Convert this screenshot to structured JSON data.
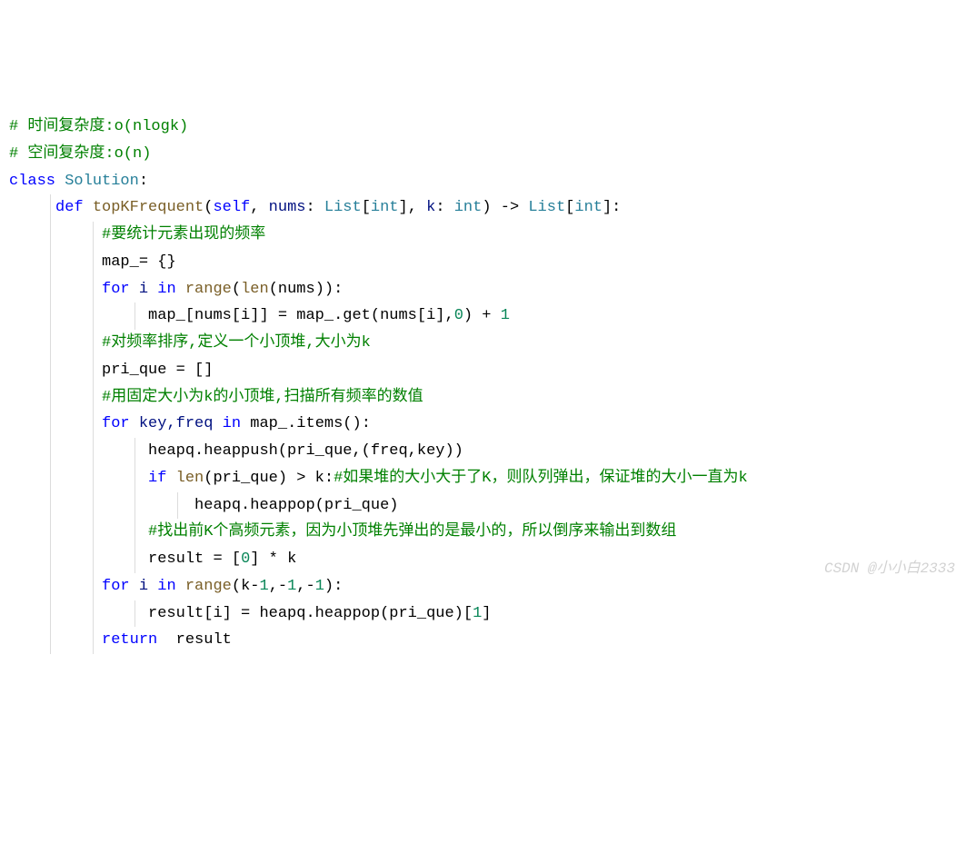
{
  "code": {
    "lines": [
      {
        "indent": 0,
        "guides": [],
        "tokens": [
          {
            "t": "# 时间复杂度:o(nlogk)",
            "c": "tok-comment"
          }
        ]
      },
      {
        "indent": 0,
        "guides": [],
        "tokens": [
          {
            "t": "# 空间复杂度:o(n)",
            "c": "tok-comment"
          }
        ]
      },
      {
        "indent": 0,
        "guides": [],
        "tokens": [
          {
            "t": "class ",
            "c": "tok-classkw"
          },
          {
            "t": "Solution",
            "c": "tok-classname"
          },
          {
            "t": ":",
            "c": "tok-op"
          }
        ]
      },
      {
        "indent": 1,
        "guides": [
          "g1"
        ],
        "tokens": [
          {
            "t": "def ",
            "c": "tok-def"
          },
          {
            "t": "topKFrequent",
            "c": "tok-func"
          },
          {
            "t": "(",
            "c": "tok-op"
          },
          {
            "t": "self",
            "c": "tok-self"
          },
          {
            "t": ", ",
            "c": "tok-op"
          },
          {
            "t": "nums",
            "c": "tok-param"
          },
          {
            "t": ": ",
            "c": "tok-op"
          },
          {
            "t": "List",
            "c": "tok-type"
          },
          {
            "t": "[",
            "c": "tok-op"
          },
          {
            "t": "int",
            "c": "tok-type"
          },
          {
            "t": "], ",
            "c": "tok-op"
          },
          {
            "t": "k",
            "c": "tok-param"
          },
          {
            "t": ": ",
            "c": "tok-op"
          },
          {
            "t": "int",
            "c": "tok-type"
          },
          {
            "t": ") -> ",
            "c": "tok-op"
          },
          {
            "t": "List",
            "c": "tok-type"
          },
          {
            "t": "[",
            "c": "tok-op"
          },
          {
            "t": "int",
            "c": "tok-type"
          },
          {
            "t": "]:",
            "c": "tok-op"
          }
        ]
      },
      {
        "indent": 2,
        "guides": [
          "g1",
          "g2"
        ],
        "tokens": [
          {
            "t": "#要统计元素出现的频率",
            "c": "tok-comment"
          }
        ]
      },
      {
        "indent": 2,
        "guides": [
          "g1",
          "g2"
        ],
        "tokens": [
          {
            "t": "map_= {}",
            "c": "tok-op"
          }
        ]
      },
      {
        "indent": 2,
        "guides": [
          "g1",
          "g2"
        ],
        "tokens": [
          {
            "t": "for ",
            "c": "tok-keyword"
          },
          {
            "t": "i ",
            "c": "tok-param"
          },
          {
            "t": "in ",
            "c": "tok-keyword"
          },
          {
            "t": "range",
            "c": "tok-func"
          },
          {
            "t": "(",
            "c": "tok-op"
          },
          {
            "t": "len",
            "c": "tok-func"
          },
          {
            "t": "(nums)):",
            "c": "tok-op"
          }
        ]
      },
      {
        "indent": 3,
        "guides": [
          "g1",
          "g2",
          "g3"
        ],
        "tokens": [
          {
            "t": "map_[nums[i]] = map_.get(nums[i],",
            "c": "tok-op"
          },
          {
            "t": "0",
            "c": "tok-num"
          },
          {
            "t": ") + ",
            "c": "tok-op"
          },
          {
            "t": "1",
            "c": "tok-num"
          }
        ]
      },
      {
        "indent": 2,
        "guides": [
          "g1",
          "g2"
        ],
        "tokens": [
          {
            "t": "#对频率排序,定义一个小顶堆,大小为k",
            "c": "tok-comment"
          }
        ]
      },
      {
        "indent": 2,
        "guides": [
          "g1",
          "g2"
        ],
        "tokens": [
          {
            "t": "pri_que = []",
            "c": "tok-op"
          }
        ]
      },
      {
        "indent": 2,
        "guides": [
          "g1",
          "g2"
        ],
        "tokens": [
          {
            "t": "#用固定大小为k的小顶堆,扫描所有频率的数值",
            "c": "tok-comment"
          }
        ]
      },
      {
        "indent": 2,
        "guides": [
          "g1",
          "g2"
        ],
        "tokens": [
          {
            "t": "for ",
            "c": "tok-keyword"
          },
          {
            "t": "key,freq ",
            "c": "tok-param"
          },
          {
            "t": "in ",
            "c": "tok-keyword"
          },
          {
            "t": "map_.items():",
            "c": "tok-op"
          }
        ]
      },
      {
        "indent": 3,
        "guides": [
          "g1",
          "g2",
          "g3"
        ],
        "tokens": [
          {
            "t": "heapq.heappush(pri_que,(freq,key))",
            "c": "tok-op"
          }
        ]
      },
      {
        "indent": 3,
        "guides": [
          "g1",
          "g2",
          "g3"
        ],
        "tokens": [
          {
            "t": "if ",
            "c": "tok-keyword"
          },
          {
            "t": "len",
            "c": "tok-func"
          },
          {
            "t": "(pri_que) > k:",
            "c": "tok-op"
          },
          {
            "t": "#如果堆的大小大于了K，则队列弹出，保证堆的大小一直为k",
            "c": "tok-comment"
          }
        ]
      },
      {
        "indent": 4,
        "guides": [
          "g1",
          "g2",
          "g3",
          "g4"
        ],
        "tokens": [
          {
            "t": "heapq.heappop(pri_que)",
            "c": "tok-op"
          }
        ]
      },
      {
        "indent": 3,
        "guides": [
          "g1",
          "g2",
          "g3"
        ],
        "tokens": [
          {
            "t": "#找出前K个高频元素，因为小顶堆先弹出的是最小的，所以倒序来输出到数组",
            "c": "tok-comment"
          }
        ]
      },
      {
        "indent": 3,
        "guides": [
          "g1",
          "g2",
          "g3"
        ],
        "tokens": [
          {
            "t": "result = [",
            "c": "tok-op"
          },
          {
            "t": "0",
            "c": "tok-num"
          },
          {
            "t": "] * k",
            "c": "tok-op"
          }
        ]
      },
      {
        "indent": 2,
        "guides": [
          "g1",
          "g2"
        ],
        "tokens": [
          {
            "t": "for ",
            "c": "tok-keyword"
          },
          {
            "t": "i ",
            "c": "tok-param"
          },
          {
            "t": "in ",
            "c": "tok-keyword"
          },
          {
            "t": "range",
            "c": "tok-func"
          },
          {
            "t": "(k-",
            "c": "tok-op"
          },
          {
            "t": "1",
            "c": "tok-num"
          },
          {
            "t": ",-",
            "c": "tok-op"
          },
          {
            "t": "1",
            "c": "tok-num"
          },
          {
            "t": ",-",
            "c": "tok-op"
          },
          {
            "t": "1",
            "c": "tok-num"
          },
          {
            "t": "):",
            "c": "tok-op"
          }
        ]
      },
      {
        "indent": 3,
        "guides": [
          "g1",
          "g2",
          "g3"
        ],
        "tokens": [
          {
            "t": "result[i] = heapq.heappop(pri_que)[",
            "c": "tok-op"
          },
          {
            "t": "1",
            "c": "tok-num"
          },
          {
            "t": "]",
            "c": "tok-op"
          }
        ]
      },
      {
        "indent": 2,
        "guides": [
          "g1",
          "g2"
        ],
        "tokens": [
          {
            "t": "return  ",
            "c": "tok-keyword"
          },
          {
            "t": "result",
            "c": "tok-op"
          }
        ]
      }
    ]
  },
  "watermark": "CSDN @小小白2333"
}
